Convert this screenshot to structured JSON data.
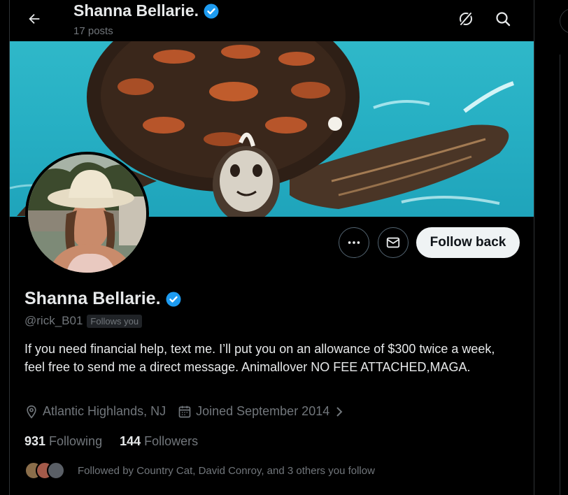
{
  "header": {
    "name": "Shanna Bellarie.",
    "posts": "17 posts"
  },
  "profile": {
    "name": "Shanna Bellarie.",
    "handle": "@rick_B01",
    "follows_you": "Follows you",
    "bio": "If you need financial help, text me. I’ll put you on an allowance of $300 twice a week, feel free to send me a direct message. Animallover NO FEE ATTACHED,MAGA.",
    "location": "Atlantic Highlands, NJ",
    "joined": "Joined September 2014",
    "following_count": "931",
    "following_label": "Following",
    "followers_count": "144",
    "followers_label": "Followers",
    "followed_by": "Followed by Country Cat, David Conroy, and 3 others you follow"
  },
  "actions": {
    "follow_back": "Follow back"
  },
  "colors": {
    "verified": "#1d9bf0",
    "background": "#000000",
    "muted_text": "#71767b",
    "follow_button_bg": "#eff3f4"
  }
}
